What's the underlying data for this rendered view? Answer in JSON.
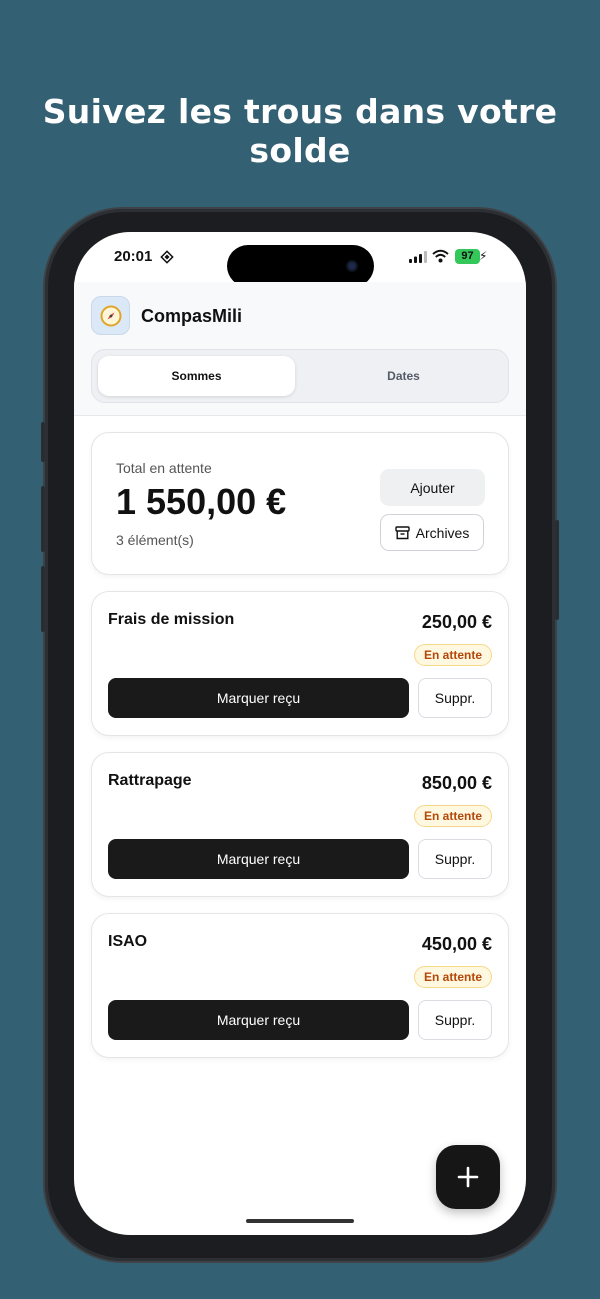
{
  "headline": "Suivez les trous dans votre solde",
  "status_bar": {
    "time": "20:01",
    "battery": "97"
  },
  "app": {
    "name": "CompasMili",
    "icon": "compass-icon"
  },
  "tabs": [
    {
      "label": "Sommes",
      "active": true
    },
    {
      "label": "Dates",
      "active": false
    }
  ],
  "summary": {
    "label": "Total en attente",
    "total": "1 550,00 €",
    "count": "3 élément(s)",
    "add_label": "Ajouter",
    "archives_label": "Archives"
  },
  "items": [
    {
      "name": "Frais de mission",
      "amount": "250,00 €",
      "status": "En attente",
      "mark_label": "Marquer reçu",
      "delete_label": "Suppr."
    },
    {
      "name": "Rattrapage",
      "amount": "850,00 €",
      "status": "En attente",
      "mark_label": "Marquer reçu",
      "delete_label": "Suppr."
    },
    {
      "name": "ISAO",
      "amount": "450,00 €",
      "status": "En attente",
      "mark_label": "Marquer reçu",
      "delete_label": "Suppr."
    }
  ],
  "colors": {
    "background": "#346073",
    "badge_text": "#b54708",
    "primary_button": "#1a1a1a"
  }
}
